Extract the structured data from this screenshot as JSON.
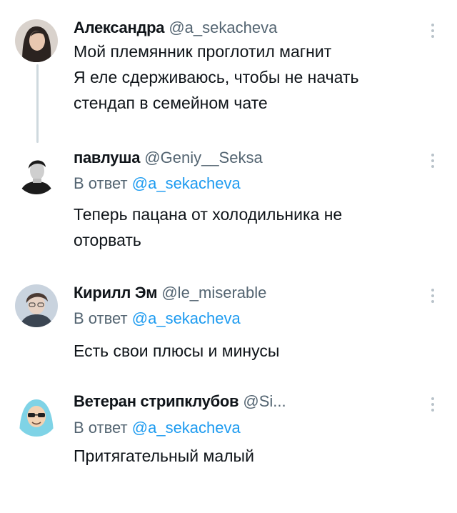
{
  "tweets": [
    {
      "name": "Александра",
      "handle": "@a_sekacheva",
      "avatar_icon": "woman-portrait-avatar",
      "lines": [
        "Мой племянник проглотил магнит",
        "Я еле сдерживаюсь, чтобы не начать",
        "стендап в семейном чате"
      ]
    },
    {
      "name": "павлуша",
      "handle": "@Geniy__Seksa",
      "avatar_icon": "man-portrait-avatar",
      "reply_prefix": "В ответ",
      "reply_to": "@a_sekacheva",
      "lines": [
        "Теперь пацана от холодильника не",
        "оторвать"
      ]
    },
    {
      "name": "Кирилл Эм",
      "handle": "@le_miserable",
      "avatar_icon": "man-portrait-avatar",
      "reply_prefix": "В ответ",
      "reply_to": "@a_sekacheva",
      "lines": [
        "Есть свои плюсы и минусы"
      ]
    },
    {
      "name": "Ветеран стрипклубов",
      "handle": "@Si...",
      "avatar_icon": "hooded-cartoon-avatar",
      "reply_prefix": "В ответ",
      "reply_to": "@a_sekacheva",
      "lines": [
        "Притягательный малый"
      ]
    }
  ],
  "colors": {
    "text": "#0f1419",
    "secondary": "#536471",
    "link": "#1d9bf0",
    "thread_line": "#cfd9de"
  }
}
